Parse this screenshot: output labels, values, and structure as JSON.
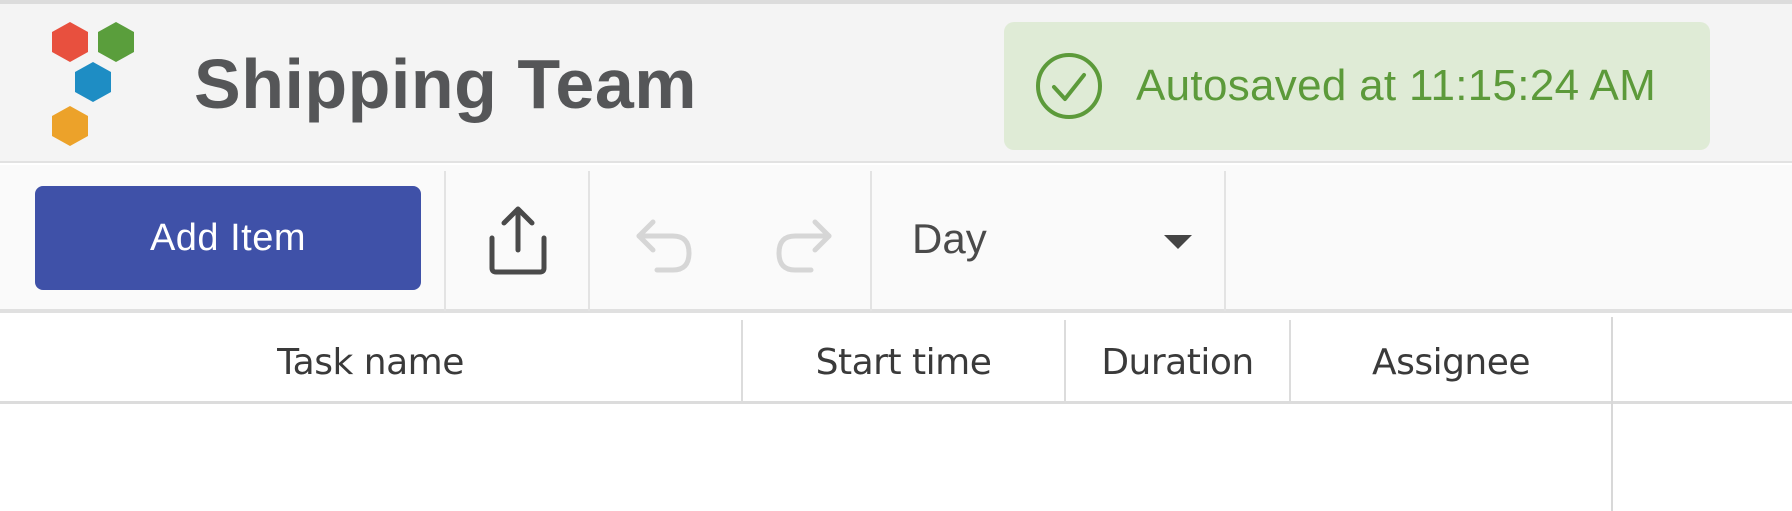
{
  "header": {
    "title": "Shipping Team",
    "logo": {
      "name": "hexagon-cluster-logo",
      "colors": [
        "#e8503e",
        "#5a9e3c",
        "#1e8dc4",
        "#eca22a"
      ]
    },
    "autosave": {
      "icon": "check-circle-icon",
      "text": "Autosaved at 11:15:24 AM",
      "color": "#5c9a3a",
      "background": "#dfebd6"
    }
  },
  "toolbar": {
    "add_item_label": "Add Item",
    "add_item_color": "#3f51a8",
    "export_icon": "share-upload-icon",
    "undo_icon": "undo-icon",
    "redo_icon": "redo-icon",
    "undo_enabled": false,
    "redo_enabled": false,
    "view_select": {
      "selected": "Day",
      "icon": "caret-down-icon"
    }
  },
  "grid": {
    "columns": [
      {
        "label": "Task name"
      },
      {
        "label": "Start time"
      },
      {
        "label": "Duration"
      },
      {
        "label": "Assignee"
      }
    ],
    "rows": []
  }
}
